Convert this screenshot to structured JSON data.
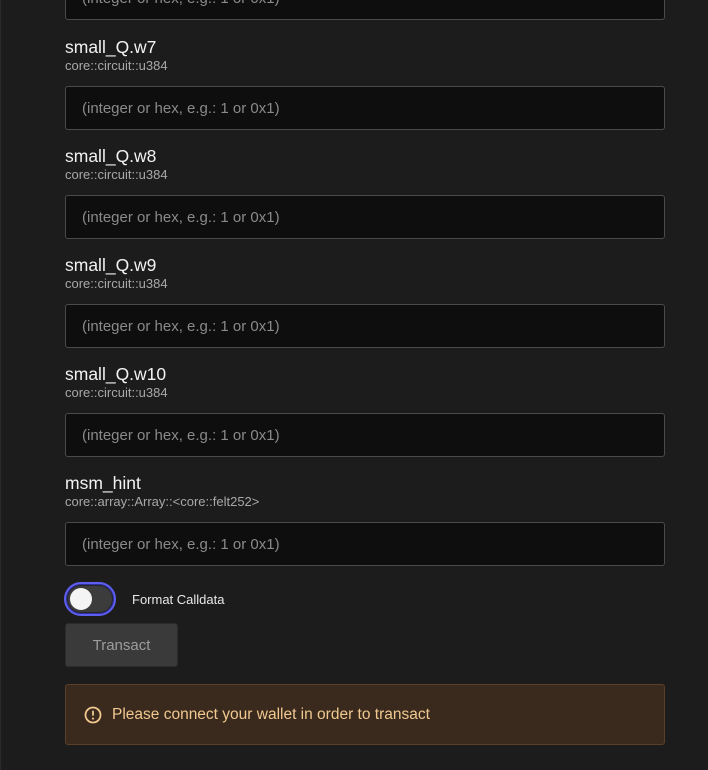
{
  "fields": [
    {
      "name": "",
      "type": "",
      "placeholder": "(integer or hex, e.g.: 1 or 0x1)"
    },
    {
      "name": "small_Q.w7",
      "type": "core::circuit::u384",
      "placeholder": "(integer or hex, e.g.: 1 or 0x1)"
    },
    {
      "name": "small_Q.w8",
      "type": "core::circuit::u384",
      "placeholder": "(integer or hex, e.g.: 1 or 0x1)"
    },
    {
      "name": "small_Q.w9",
      "type": "core::circuit::u384",
      "placeholder": "(integer or hex, e.g.: 1 or 0x1)"
    },
    {
      "name": "small_Q.w10",
      "type": "core::circuit::u384",
      "placeholder": "(integer or hex, e.g.: 1 or 0x1)"
    },
    {
      "name": "msm_hint",
      "type": "core::array::Array::<core::felt252>",
      "placeholder": "(integer or hex, e.g.: 1 or 0x1)"
    }
  ],
  "format_calldata": {
    "label": "Format Calldata",
    "enabled": false
  },
  "transact": {
    "label": "Transact"
  },
  "alert": {
    "message": "Please connect your wallet in order to transact",
    "icon": "alert-circle-icon"
  },
  "colors": {
    "accent": "#5e5ef0",
    "warning_text": "#f0c890",
    "warning_bg": "#3a2a1d"
  }
}
